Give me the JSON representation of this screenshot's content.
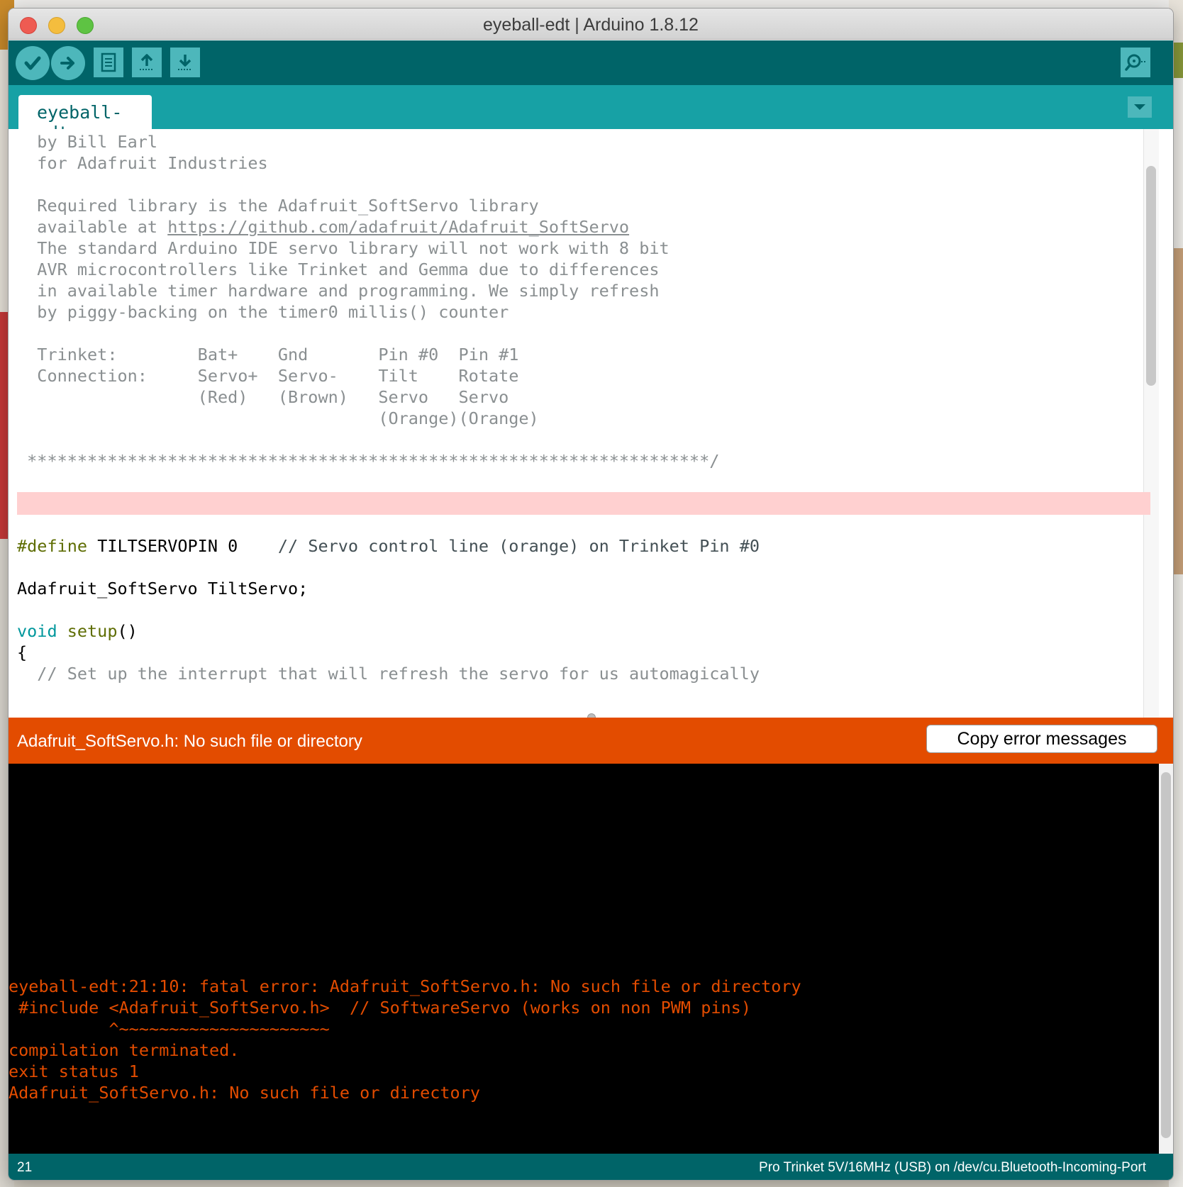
{
  "window": {
    "title": "eyeball-edt | Arduino 1.8.12"
  },
  "toolbar": {
    "verify": "verify-icon",
    "upload": "upload-arrow-icon",
    "new": "new-file-icon",
    "open": "open-icon",
    "save": "save-icon",
    "serial_monitor": "magnifier-icon"
  },
  "tabs": [
    {
      "label": "eyeball-edt"
    }
  ],
  "editor": {
    "lines": [
      {
        "type": "comment",
        "text": "  by Bill Earl"
      },
      {
        "type": "comment",
        "text": "  for Adafruit Industries"
      },
      {
        "type": "blank",
        "text": ""
      },
      {
        "type": "comment",
        "text": "  Required library is the Adafruit_SoftServo library"
      },
      {
        "type": "comment-url",
        "text": "  available at ",
        "url": "https://github.com/adafruit/Adafruit_SoftServo"
      },
      {
        "type": "comment",
        "text": "  The standard Arduino IDE servo library will not work with 8 bit"
      },
      {
        "type": "comment",
        "text": "  AVR microcontrollers like Trinket and Gemma due to differences"
      },
      {
        "type": "comment",
        "text": "  in available timer hardware and programming. We simply refresh"
      },
      {
        "type": "comment",
        "text": "  by piggy-backing on the timer0 millis() counter"
      },
      {
        "type": "blank",
        "text": ""
      },
      {
        "type": "comment",
        "text": "  Trinket:        Bat+    Gnd       Pin #0  Pin #1"
      },
      {
        "type": "comment",
        "text": "  Connection:     Servo+  Servo-    Tilt    Rotate"
      },
      {
        "type": "comment",
        "text": "                  (Red)   (Brown)   Servo   Servo"
      },
      {
        "type": "comment",
        "text": "                                    (Orange)(Orange)"
      },
      {
        "type": "blank",
        "text": ""
      },
      {
        "type": "comment",
        "text": " ********************************************************************/"
      },
      {
        "type": "blank",
        "text": ""
      },
      {
        "type": "include",
        "directive": "#include",
        "header": " <Adafruit_SoftServo.h>",
        "comment": "  // SoftwareServo (works on non PWM pins)"
      },
      {
        "type": "blank",
        "text": ""
      },
      {
        "type": "define",
        "directive": "#define",
        "rest": " TILTSERVOPIN 0",
        "comment": "    // Servo control line (orange) on Trinket Pin #0"
      },
      {
        "type": "blank",
        "text": ""
      },
      {
        "type": "plain",
        "text": "Adafruit_SoftServo TiltServo;"
      },
      {
        "type": "blank",
        "text": ""
      },
      {
        "type": "func",
        "ret": "void",
        "name": " setup",
        "rest": "()"
      },
      {
        "type": "plain",
        "text": "{"
      },
      {
        "type": "comment",
        "text": "  // Set up the interrupt that will refresh the servo for us automagically"
      }
    ]
  },
  "errbar": {
    "message": "Adafruit_SoftServo.h: No such file or directory",
    "copy_button": "Copy error messages"
  },
  "console": {
    "lines": [
      "eyeball-edt:21:10: fatal error: Adafruit_SoftServo.h: No such file or directory",
      " #include <Adafruit_SoftServo.h>  // SoftwareServo (works on non PWM pins)",
      "          ^~~~~~~~~~~~~~~~~~~~~~",
      "compilation terminated.",
      "exit status 1",
      "Adafruit_SoftServo.h: No such file or directory"
    ]
  },
  "status": {
    "line_number": "21",
    "board": "Pro Trinket 5V/16MHz (USB) on /dev/cu.Bluetooth-Incoming-Port"
  },
  "colors": {
    "teal_dark": "#006468",
    "teal_mid": "#17a1a5",
    "teal_light": "#4db7bb",
    "error_orange": "#e34c00",
    "error_line_bg": "#ffd0d0"
  }
}
